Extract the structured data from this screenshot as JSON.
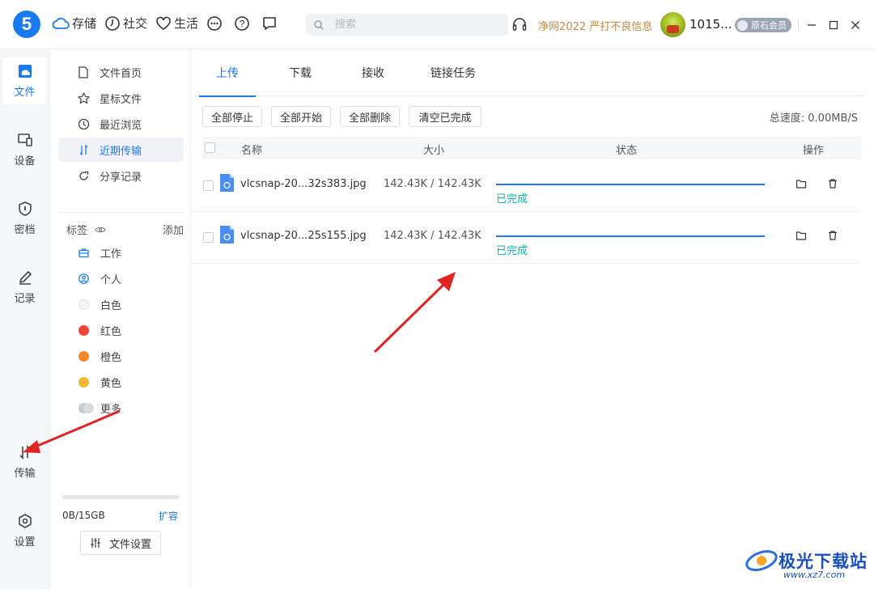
{
  "top": {
    "logo": "5",
    "nav": [
      "存储",
      "社交",
      "生活"
    ],
    "search_placeholder": "搜索",
    "announce": "净网2022 严打不良信息",
    "username": "1015...",
    "vip_label": "原石会员"
  },
  "rail": {
    "items": [
      "文件",
      "设备",
      "密档",
      "记录",
      "传输",
      "设置"
    ]
  },
  "side": {
    "items": [
      "文件首页",
      "星标文件",
      "最近浏览",
      "近期传输",
      "分享记录"
    ],
    "tags_label": "标签",
    "tags_add": "添加",
    "tags": [
      {
        "label": "工作",
        "color": "#1a7bf0"
      },
      {
        "label": "个人",
        "color": "#1a7bf0"
      },
      {
        "label": "白色",
        "color": "#f2f2f2"
      },
      {
        "label": "红色",
        "color": "#f04438"
      },
      {
        "label": "橙色",
        "color": "#f5892a"
      },
      {
        "label": "黄色",
        "color": "#f7b731"
      },
      {
        "label": "更多",
        "color": "#c9cbce"
      }
    ],
    "quota_text": "0B/15GB",
    "quota_link": "扩容",
    "file_settings": "文件设置"
  },
  "main": {
    "tabs": [
      "上传",
      "下载",
      "接收",
      "链接任务"
    ],
    "buttons": [
      "全部停止",
      "全部开始",
      "全部删除",
      "清空已完成"
    ],
    "speed": "总速度: 0.00MB/S",
    "columns": {
      "name": "名称",
      "size": "大小",
      "status": "状态",
      "ops": "操作"
    },
    "rows": [
      {
        "name": "vlcsnap-20...32s383.jpg",
        "size": "142.43K / 142.43K",
        "status": "已完成",
        "progress": 1.0
      },
      {
        "name": "vlcsnap-20...25s155.jpg",
        "size": "142.43K / 142.43K",
        "status": "已完成",
        "progress": 1.0
      }
    ]
  },
  "watermark": {
    "text": "极光下载站",
    "url": "www.xz7.com"
  },
  "colors": {
    "accent": "#1a7bf0",
    "done": "#13b2a3",
    "announce": "#c68a3a"
  }
}
